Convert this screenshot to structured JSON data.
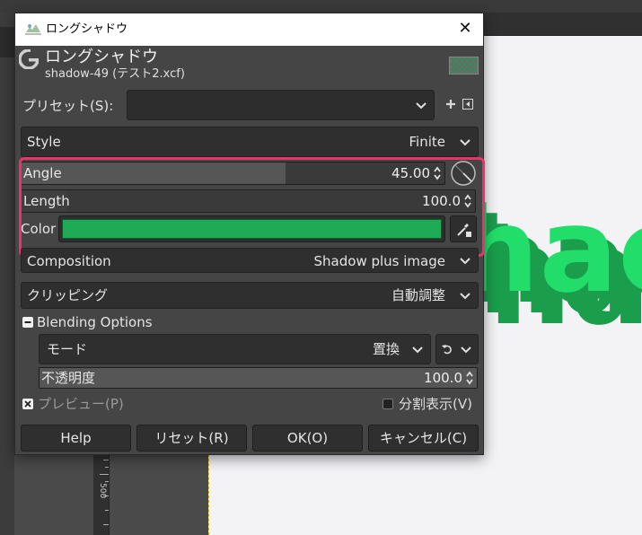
{
  "dialog": {
    "window_title": "ロングシャドウ",
    "header_title": "ロングシャドウ",
    "header_subtitle": "shadow-49 (テスト2.xcf)",
    "preset_label": "プリセット(S):",
    "preset_value": "",
    "style": {
      "label": "Style",
      "value": "Finite"
    },
    "angle": {
      "label": "Angle",
      "value": "45.00",
      "fill_fraction": 0.625
    },
    "length": {
      "label": "Length",
      "value": "100.0",
      "fill_fraction": 0.1
    },
    "color": {
      "label": "Color",
      "swatch": "#1faa55"
    },
    "composition": {
      "label": "Composition",
      "value": "Shadow plus image"
    },
    "clipping": {
      "label": "クリッピング",
      "value": "自動調整"
    },
    "blending": {
      "label": "Blending Options",
      "mode_label": "モード",
      "mode_value": "置換",
      "opacity_label": "不透明度",
      "opacity_value": "100.0"
    },
    "preview_label": "プレビュー(P)",
    "split_view_label": "分割表示(V)",
    "buttons": {
      "help": "Help",
      "reset": "リセット(R)",
      "ok": "OK(O)",
      "cancel": "キャンセル(C)"
    }
  },
  "workspace": {
    "ruler_label": "500",
    "canvas_text": "hac",
    "shadow_color": "#1a9e4c",
    "text_color": "#22dd6a"
  },
  "colors": {
    "highlight": "#e9336b",
    "dialog_bg": "#454545"
  }
}
